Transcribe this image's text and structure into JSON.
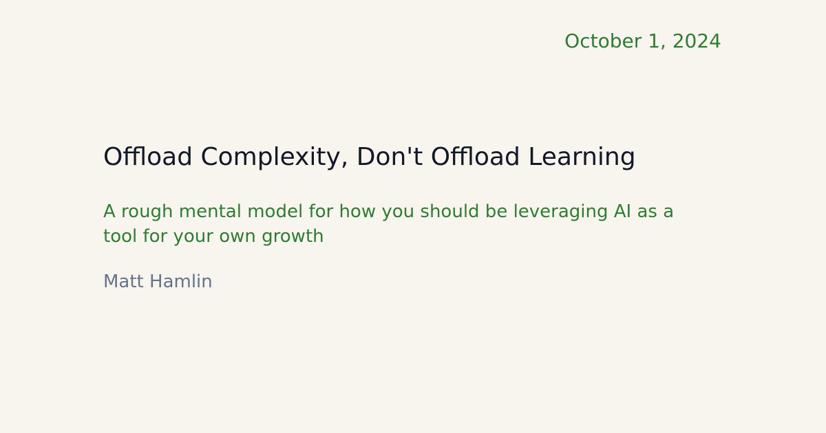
{
  "post": {
    "date": "October 1, 2024",
    "title": "Offload Complexity, Don't Offload Learning",
    "subtitle": "A rough mental model for how you should be leveraging AI as a tool for your own growth",
    "author": "Matt Hamlin"
  },
  "colors": {
    "background": "#f8f4ee",
    "accent_green": "#2e7d32",
    "title_text": "#111827",
    "author_text": "#64748b"
  }
}
